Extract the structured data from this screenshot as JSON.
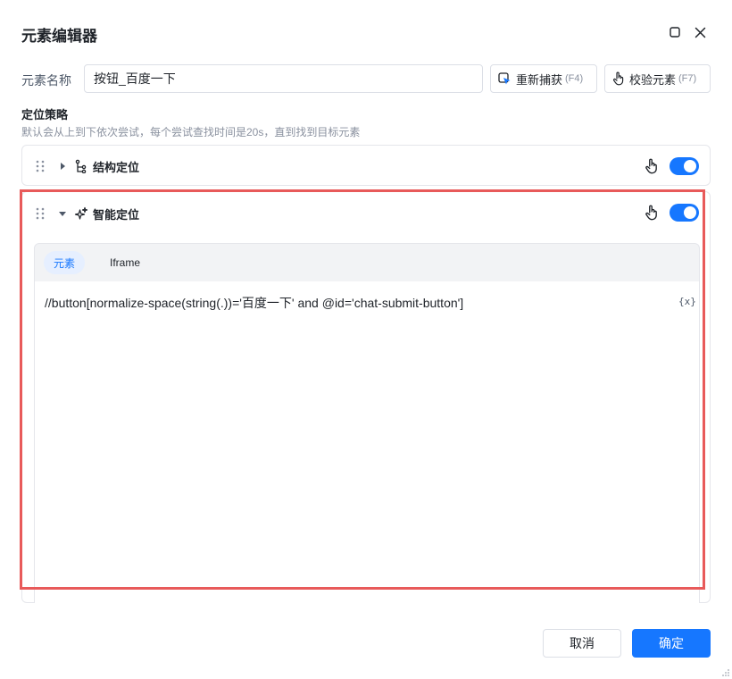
{
  "dialog": {
    "title": "元素编辑器"
  },
  "element_name": {
    "label": "元素名称",
    "value": "按钮_百度一下"
  },
  "toolbar": {
    "recapture_label": "重新捕获",
    "recapture_shortcut": "(F4)",
    "verify_label": "校验元素",
    "verify_shortcut": "(F7)"
  },
  "strategy": {
    "title": "定位策略",
    "description": "默认会从上到下依次尝试，每个尝试查找时间是20s，直到找到目标元素",
    "items": [
      {
        "label": "结构定位",
        "expanded": false,
        "enabled": true,
        "icon": "tree-structure-icon"
      },
      {
        "label": "智能定位",
        "expanded": true,
        "enabled": true,
        "icon": "sparkle-icon"
      }
    ]
  },
  "smart_panel": {
    "tabs": [
      {
        "label": "元素",
        "active": true
      },
      {
        "label": "Iframe",
        "active": false
      }
    ],
    "xpath": "//button[normalize-space(string(.))='百度一下' and @id='chat-submit-button']",
    "variable_button": "{x}"
  },
  "footer": {
    "cancel_label": "取消",
    "ok_label": "确定"
  },
  "colors": {
    "accent": "#1677ff",
    "highlight": "#e85a5a"
  }
}
